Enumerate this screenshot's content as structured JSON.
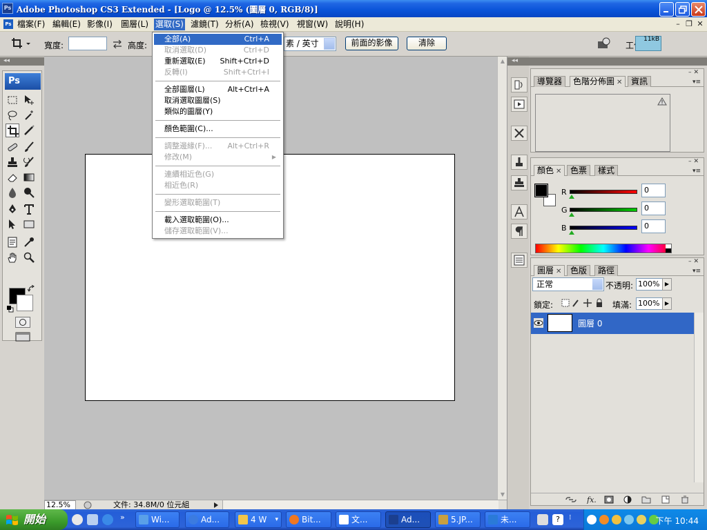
{
  "window": {
    "title": "Adobe Photoshop CS3 Extended - [Logo @ 12.5% (圖層 0, RGB/8)]",
    "app_icon_text": "Ps",
    "doc_icon_text": "Ps"
  },
  "menubar": {
    "items": [
      "檔案(F)",
      "編輯(E)",
      "影像(I)",
      "圖層(L)",
      "選取(S)",
      "濾鏡(T)",
      "分析(A)",
      "檢視(V)",
      "視窗(W)",
      "說明(H)"
    ],
    "active_index": 4
  },
  "options": {
    "width_label": "寬度:",
    "height_label": "高度:",
    "unit_select": "素 / 英寸",
    "front_image_button": "前面的影像",
    "clear_button": "清除",
    "workspace_label": "工作區",
    "size_badge": "11kB"
  },
  "selection_menu": {
    "items": [
      {
        "label": "全部(A)",
        "shortcut": "Ctrl+A",
        "enabled": true,
        "highlighted": true
      },
      {
        "label": "取消選取(D)",
        "shortcut": "Ctrl+D",
        "enabled": false
      },
      {
        "label": "重新選取(E)",
        "shortcut": "Shift+Ctrl+D",
        "enabled": true
      },
      {
        "label": "反轉(I)",
        "shortcut": "Shift+Ctrl+I",
        "enabled": false
      },
      {
        "label": "全部圖層(L)",
        "shortcut": "Alt+Ctrl+A",
        "enabled": true
      },
      {
        "label": "取消選取圖層(S)",
        "shortcut": "",
        "enabled": true
      },
      {
        "label": "類似的圖層(Y)",
        "shortcut": "",
        "enabled": true
      },
      {
        "label": "顏色範圍(C)...",
        "shortcut": "",
        "enabled": true
      },
      {
        "label": "調整邊緣(F)...",
        "shortcut": "Alt+Ctrl+R",
        "enabled": false
      },
      {
        "label": "修改(M)",
        "shortcut": "",
        "enabled": false,
        "submenu": true
      },
      {
        "label": "連續相近色(G)",
        "shortcut": "",
        "enabled": false
      },
      {
        "label": "相近色(R)",
        "shortcut": "",
        "enabled": false
      },
      {
        "label": "變形選取範圍(T)",
        "shortcut": "",
        "enabled": false
      },
      {
        "label": "載入選取範圍(O)...",
        "shortcut": "",
        "enabled": true
      },
      {
        "label": "儲存選取範圍(V)...",
        "shortcut": "",
        "enabled": false
      }
    ]
  },
  "toolbox": {
    "logo": "Ps",
    "foreground_color": "#000000",
    "background_color": "#ffffff"
  },
  "status": {
    "zoom": "12.5%",
    "doc_info": "文件: 34.8M/0 位元組"
  },
  "panels": {
    "navigator_tabs": [
      "導覽器",
      "色階分佈圖",
      "資訊"
    ],
    "navigator_active": 1,
    "color_tabs": [
      "顏色",
      "色票",
      "樣式"
    ],
    "color_active": 0,
    "color": {
      "channels": [
        {
          "name": "R",
          "value": "0",
          "gradient": "#ff0000"
        },
        {
          "name": "G",
          "value": "0",
          "gradient": "#00cc00"
        },
        {
          "name": "B",
          "value": "0",
          "gradient": "#0000ff"
        }
      ]
    },
    "layers_tabs": [
      "圖層",
      "色版",
      "路徑"
    ],
    "layers_active": 0,
    "layers": {
      "blend_mode": "正常",
      "opacity_label": "不透明:",
      "opacity": "100%",
      "lock_label": "鎖定:",
      "fill_label": "填滿:",
      "fill": "100%",
      "items": [
        {
          "name": "圖層 0",
          "visible": true,
          "selected": true
        }
      ]
    }
  },
  "taskbar": {
    "start": "開始",
    "tasks": [
      {
        "label": "Wi...",
        "color": "#5aa0e8"
      },
      {
        "label": "Ad...",
        "color": "#3b7be0"
      },
      {
        "label": "4 W",
        "color": "#f2c64a"
      },
      {
        "label": "Bit...",
        "color": "#ee7722"
      },
      {
        "label": "文...",
        "color": "#ffffff"
      },
      {
        "label": "Ad...",
        "color": "#1b3f8f",
        "active": true
      },
      {
        "label": "5.JP...",
        "color": "#c8a040"
      },
      {
        "label": "未...",
        "color": "#2a7ad8"
      }
    ],
    "clock": "下午 10:44"
  }
}
